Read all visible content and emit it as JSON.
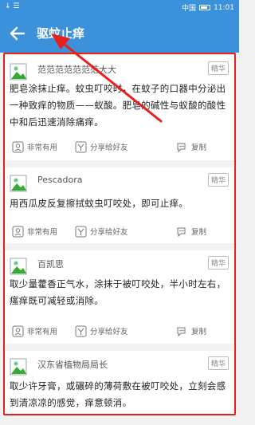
{
  "status": {
    "left_glyph": "↓ ☰",
    "carrier": "中国",
    "time": "11:01"
  },
  "appbar": {
    "title": "驱蚊止痒"
  },
  "badge_label": "精华",
  "actions": {
    "useful": "非常有用",
    "share": "分享给好友",
    "copy": "复制"
  },
  "cards": [
    {
      "name": "范范范范范范范大大",
      "content": "肥皂涂抹止痒。蚊虫叮咬时，在蚊子的口器中分泌出一种致痒的物质——蚁酸。肥皂的碱性与蚁酸的酸性中和后迅速消除痛痒。"
    },
    {
      "name": "Pescadora",
      "content": "用西瓜皮反复擦拭蚊虫叮咬处，即可止痒。"
    },
    {
      "name": "百凯思",
      "content": "取少量藿香正气水，涂抹于被叮咬处，半小时左右，瘙痒既可减轻或消除。"
    },
    {
      "name": "汉东省植物局局长",
      "content": "取少许牙膏，或碾碎的薄荷敷在被叮咬处，立刻会感到清凉凉的感觉，痒意顿消。"
    }
  ],
  "colors": {
    "appbar": "#3c91db",
    "annotation": "#e8201c"
  }
}
